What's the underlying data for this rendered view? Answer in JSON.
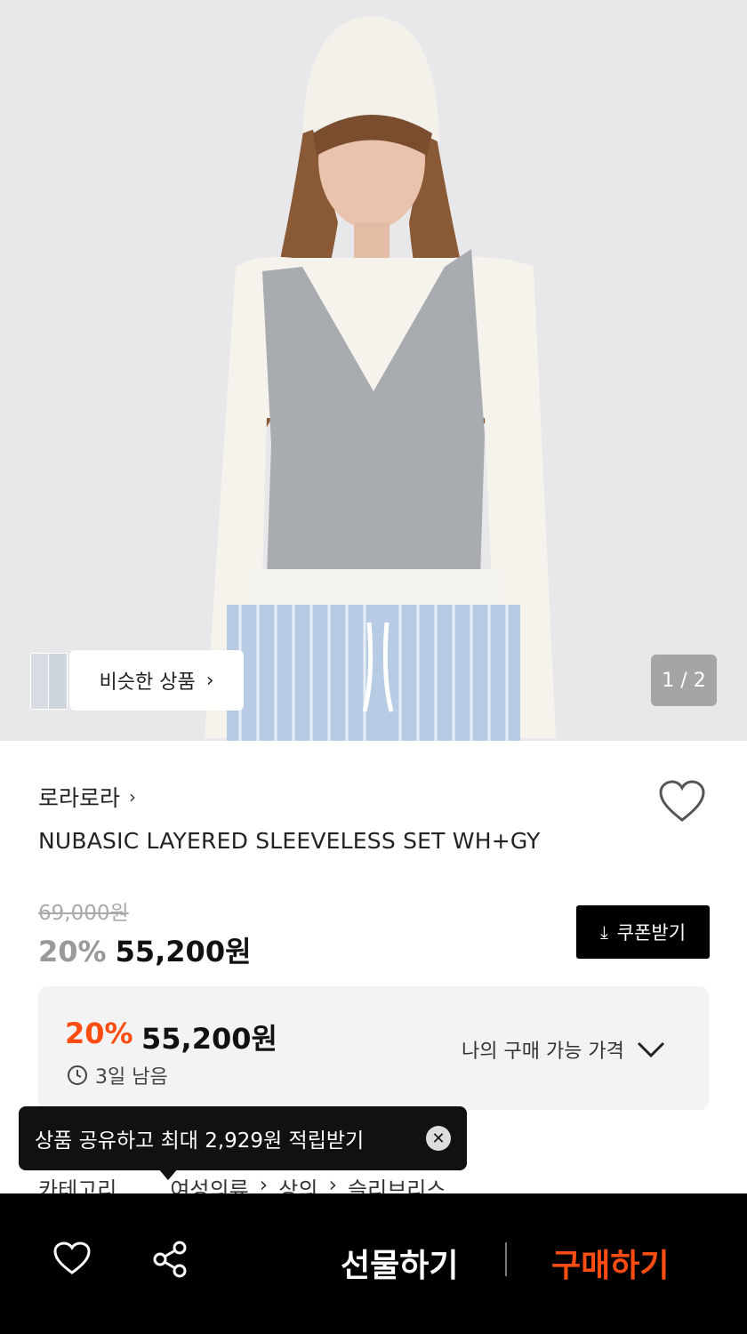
{
  "hero": {
    "similar_label": "비슷한 상품",
    "page_counter": "1 / 2"
  },
  "product": {
    "brand": "로라로라",
    "name": "NUBASIC LAYERED SLEEVELESS SET WH+GY",
    "original_price": "69,000원",
    "discount_rate": "20%",
    "sale_price": "55,200원",
    "coupon_label": "쿠폰받기"
  },
  "my_price": {
    "discount_rate": "20%",
    "price": "55,200원",
    "remaining": "3일 남음",
    "label": "나의 구매 가능 가격"
  },
  "toast": {
    "message": "상품 공유하고 최대 2,929원 적립받기"
  },
  "category": {
    "label": "카테고리",
    "path": [
      "여성의류",
      "상의",
      "슬리브리스"
    ]
  },
  "bottom_bar": {
    "gift_label": "선물하기",
    "buy_label": "구매하기"
  },
  "colors": {
    "accent": "#ff4d12",
    "bar": "#000000"
  }
}
